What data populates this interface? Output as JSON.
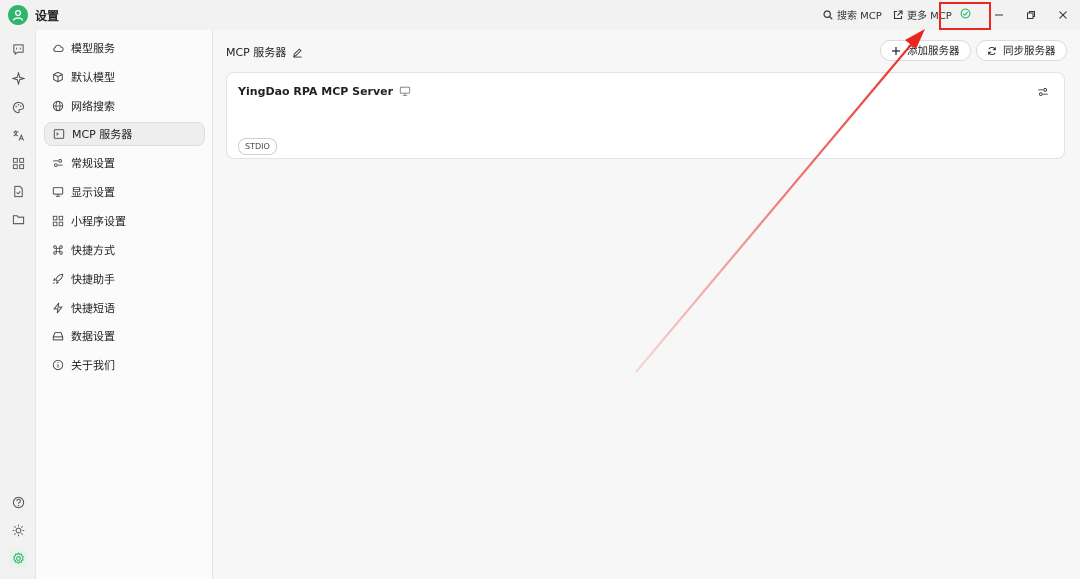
{
  "app": {
    "title": "设置"
  },
  "titlebar": {
    "search_mcp": "搜索 MCP",
    "more_mcp": "更多 MCP",
    "status_icon": "check-circle-icon"
  },
  "menu": {
    "items": [
      {
        "label": "模型服务",
        "icon": "cloud-icon"
      },
      {
        "label": "默认模型",
        "icon": "cube-icon"
      },
      {
        "label": "网络搜索",
        "icon": "globe-icon"
      },
      {
        "label": "MCP 服务器",
        "icon": "terminal-icon",
        "active": true
      },
      {
        "label": "常规设置",
        "icon": "sliders-icon"
      },
      {
        "label": "显示设置",
        "icon": "monitor-icon"
      },
      {
        "label": "小程序设置",
        "icon": "grid-icon"
      },
      {
        "label": "快捷方式",
        "icon": "command-icon"
      },
      {
        "label": "快捷助手",
        "icon": "rocket-icon"
      },
      {
        "label": "快捷短语",
        "icon": "zap-icon"
      },
      {
        "label": "数据设置",
        "icon": "drive-icon"
      },
      {
        "label": "关于我们",
        "icon": "info-icon"
      }
    ]
  },
  "main": {
    "title": "MCP 服务器",
    "add_button": "添加服务器",
    "sync_button": "同步服务器",
    "server": {
      "name": "YingDao RPA MCP Server",
      "tag": "STDIO"
    }
  },
  "colors": {
    "accent_green": "#2fb66c",
    "annotation_red": "#e8271f"
  }
}
